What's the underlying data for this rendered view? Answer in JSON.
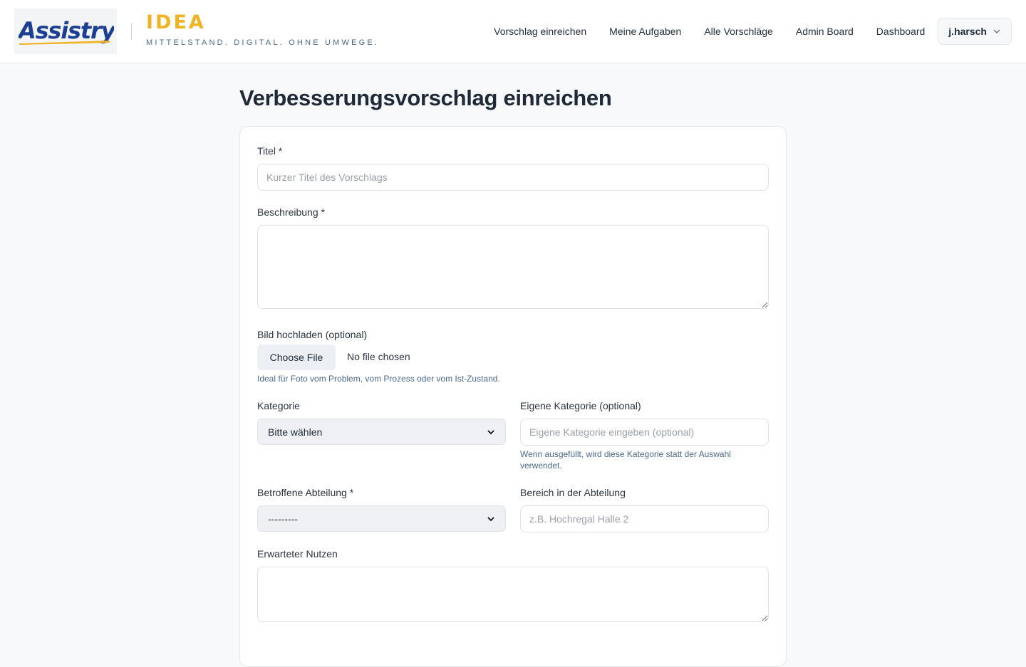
{
  "brand": {
    "logo_text": "Assistry",
    "app_name": "IDEA",
    "tagline": "MITTELSTAND. DIGITAL. OHNE UMWEGE."
  },
  "nav": {
    "items": [
      "Vorschlag einreichen",
      "Meine Aufgaben",
      "Alle Vorschläge",
      "Admin Board",
      "Dashboard"
    ],
    "user": "j.harsch"
  },
  "page": {
    "title": "Verbesserungsvorschlag einreichen"
  },
  "form": {
    "titel": {
      "label": "Titel *",
      "placeholder": "Kurzer Titel des Vorschlags",
      "value": ""
    },
    "beschreibung": {
      "label": "Beschreibung *",
      "value": ""
    },
    "bild": {
      "label": "Bild hochladen (optional)",
      "button": "Choose File",
      "status": "No file chosen",
      "help": "Ideal für Foto vom Problem, vom Prozess oder vom Ist-Zustand."
    },
    "kategorie": {
      "label": "Kategorie",
      "selected": "Bitte wählen"
    },
    "eigene_kategorie": {
      "label": "Eigene Kategorie (optional)",
      "placeholder": "Eigene Kategorie eingeben (optional)",
      "help": "Wenn ausgefüllt, wird diese Kategorie statt der Auswahl verwendet."
    },
    "abteilung": {
      "label": "Betroffene Abteilung *",
      "selected": "---------"
    },
    "bereich": {
      "label": "Bereich in der Abteilung",
      "placeholder": "z.B. Hochregal Halle 2"
    },
    "nutzen": {
      "label": "Erwarteter Nutzen",
      "value": ""
    }
  },
  "colors": {
    "brand_yellow": "#f0b323",
    "logo_blue": "#1c3f94",
    "text_dark": "#1f2937"
  }
}
